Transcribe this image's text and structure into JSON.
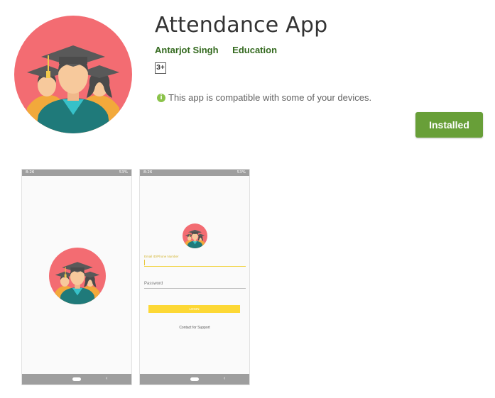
{
  "app": {
    "title": "Attendance App",
    "developer": "Antarjot Singh",
    "category": "Education",
    "content_rating": "3+",
    "compatibility": "This app is compatible with some of your devices.",
    "install_button": "Installed"
  },
  "colors": {
    "accent_green": "#689f38",
    "link_green": "#33691e",
    "icon_red": "#f36c72",
    "teal": "#27797a"
  },
  "screenshots": [
    {
      "status_time": "8:26",
      "status_battery": "53%",
      "nav_back": "‹"
    },
    {
      "status_time": "8:26",
      "status_battery": "53%",
      "nav_back": "‹",
      "email_label": "Email ID/Phone Number",
      "password_placeholder": "Password",
      "login_button": "LOGIN",
      "support_link": "Contact for Support"
    }
  ]
}
